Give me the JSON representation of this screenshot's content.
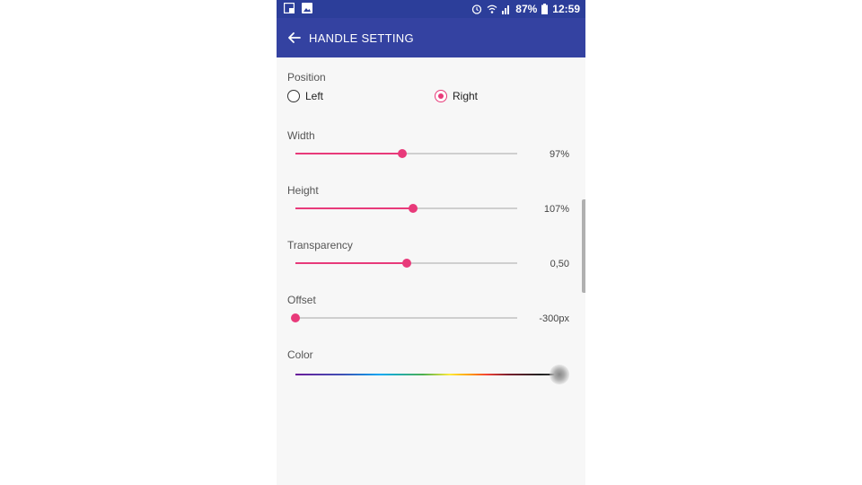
{
  "status_bar": {
    "battery": "87%",
    "time": "12:59",
    "left_icons": [
      "notification-box-icon",
      "image-icon"
    ],
    "right_icons": [
      "alarm-icon",
      "wifi-icon",
      "signal-icon",
      "battery-icon"
    ]
  },
  "app_bar": {
    "title": "HANDLE SETTING",
    "back_icon": "arrow-left-icon",
    "color": "#3442a1"
  },
  "position": {
    "label": "Position",
    "options": [
      {
        "label": "Left",
        "selected": false
      },
      {
        "label": "Right",
        "selected": true
      }
    ]
  },
  "sliders": [
    {
      "label": "Width",
      "value_text": "97%",
      "fraction": 0.48
    },
    {
      "label": "Height",
      "value_text": "107%",
      "fraction": 0.53
    },
    {
      "label": "Transparency",
      "value_text": "0,50",
      "fraction": 0.5
    },
    {
      "label": "Offset",
      "value_text": "-300px",
      "fraction": 0.0
    }
  ],
  "color": {
    "label": "Color",
    "fraction": 0.99
  },
  "accent_color": "#e83a7a"
}
